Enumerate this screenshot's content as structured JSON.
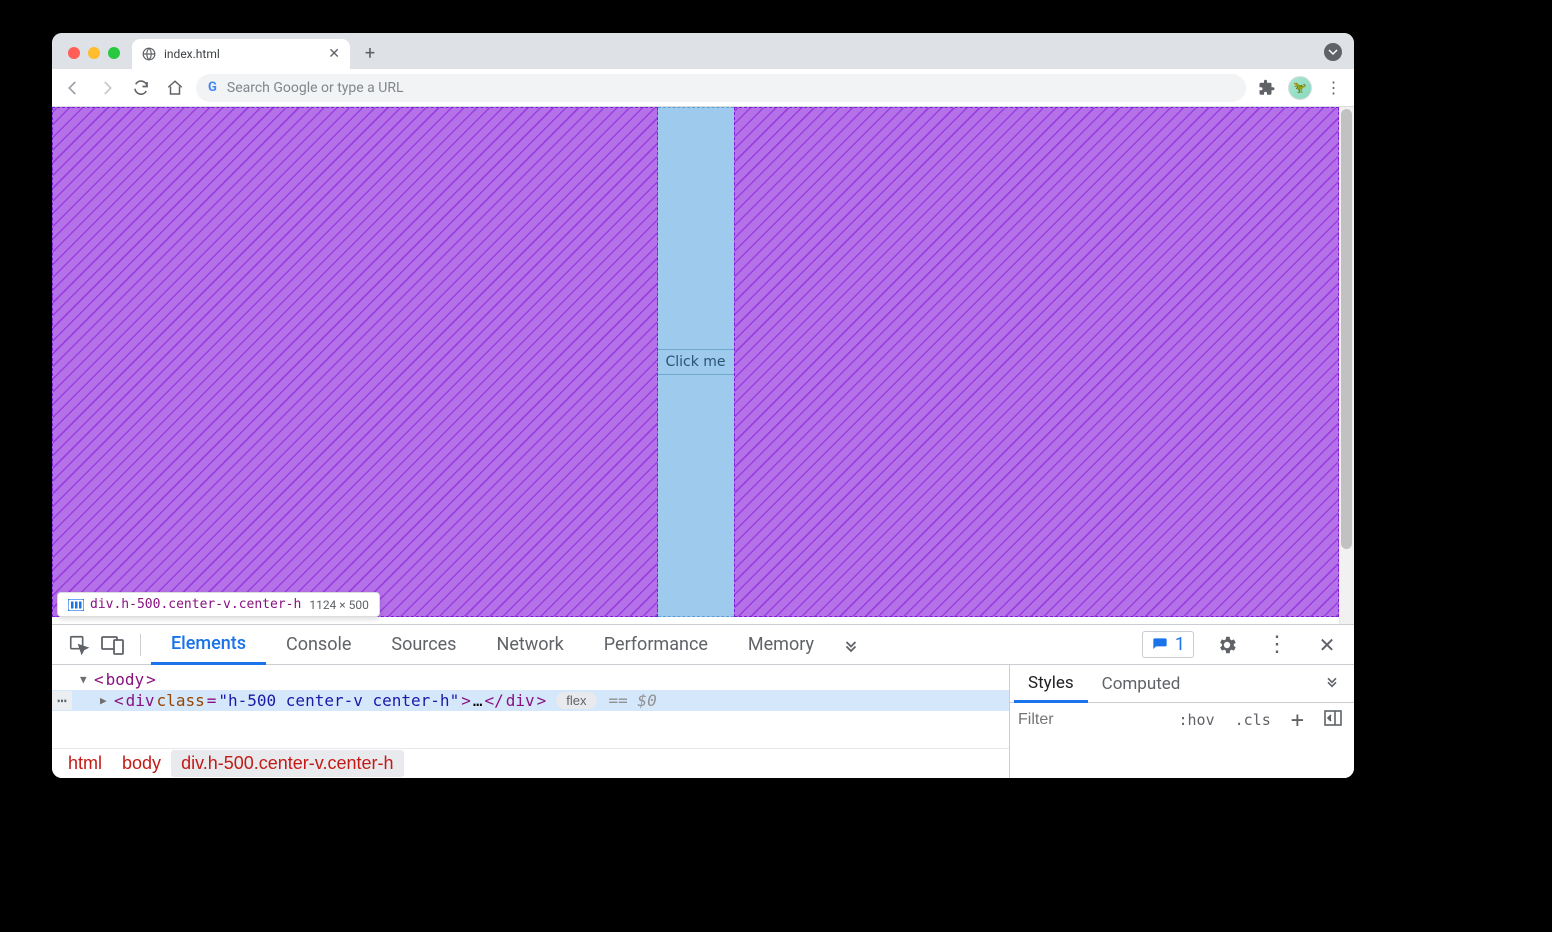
{
  "tab": {
    "title": "index.html"
  },
  "omnibox": {
    "placeholder": "Search Google or type a URL"
  },
  "page": {
    "button_label": "Click me",
    "tooltip_selector": "div.h-500.center-v.center-h",
    "tooltip_dims": "1124 × 500"
  },
  "devtools": {
    "tabs": [
      "Elements",
      "Console",
      "Sources",
      "Network",
      "Performance",
      "Memory"
    ],
    "active_tab": "Elements",
    "issue_count": "1",
    "dom": {
      "body_open": "<body>",
      "div_open_prefix": "<div ",
      "div_attr_name": "class",
      "div_attr_val": "h-500 center-v center-h",
      "div_open_suffix": ">",
      "ellipsis": "…",
      "div_close": "</div>",
      "flex_label": "flex",
      "eq0": "== $0"
    },
    "breadcrumbs": [
      "html",
      "body",
      "div.h-500.center-v.center-h"
    ],
    "styles": {
      "tabs": [
        "Styles",
        "Computed"
      ],
      "filter_placeholder": "Filter",
      "hov": ":hov",
      "cls": ".cls"
    }
  }
}
